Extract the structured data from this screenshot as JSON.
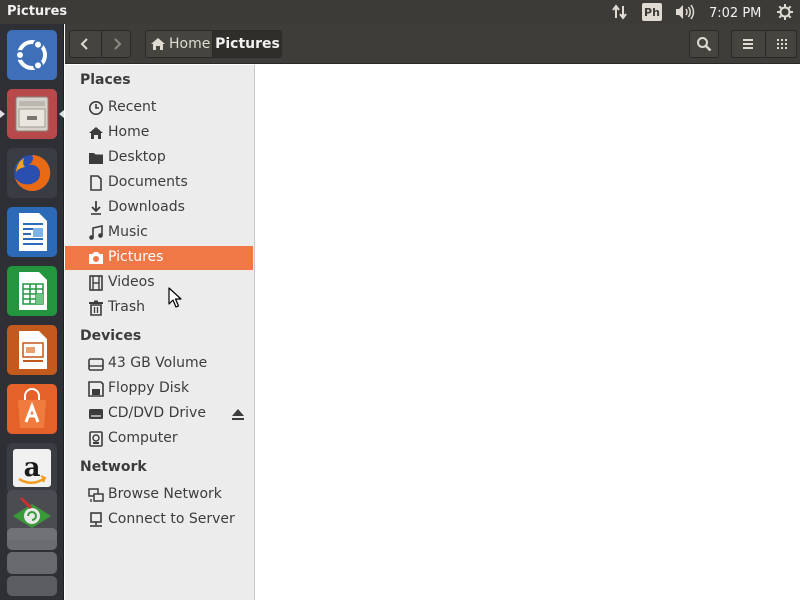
{
  "window": {
    "title": "Pictures"
  },
  "top_panel": {
    "keyboard_layout": "Ph",
    "clock": "7:02 PM",
    "icons": [
      "network-arrows-icon",
      "keyboard-layout-icon",
      "volume-icon",
      "gear-icon"
    ]
  },
  "launcher": {
    "items": [
      {
        "name": "ubuntu-dash",
        "color": "#3c6eb4"
      },
      {
        "name": "files",
        "color": "#b44646"
      },
      {
        "name": "firefox",
        "color": "#e66000"
      },
      {
        "name": "libreoffice-writer",
        "color": "#2a6ab8"
      },
      {
        "name": "libreoffice-calc",
        "color": "#1e8c3c"
      },
      {
        "name": "libreoffice-impress",
        "color": "#c0571b"
      },
      {
        "name": "ubuntu-software",
        "color": "#e8642a"
      },
      {
        "name": "amazon",
        "color": "#3a3a3a"
      },
      {
        "name": "software-updater",
        "color": "#6a6a6a"
      }
    ]
  },
  "headerbar": {
    "breadcrumbs": [
      "Home",
      "Pictures"
    ],
    "icons": [
      "back-icon",
      "forward-icon",
      "home-icon",
      "search-icon",
      "menu-icon",
      "grid-view-icon"
    ]
  },
  "sidebar": {
    "places_title": "Places",
    "places": [
      {
        "label": "Recent",
        "icon": "clock-icon"
      },
      {
        "label": "Home",
        "icon": "home-icon"
      },
      {
        "label": "Desktop",
        "icon": "folder-icon"
      },
      {
        "label": "Documents",
        "icon": "document-icon"
      },
      {
        "label": "Downloads",
        "icon": "download-icon"
      },
      {
        "label": "Music",
        "icon": "music-icon"
      },
      {
        "label": "Pictures",
        "icon": "camera-icon",
        "active": true
      },
      {
        "label": "Videos",
        "icon": "film-icon"
      },
      {
        "label": "Trash",
        "icon": "trash-icon"
      }
    ],
    "devices_title": "Devices",
    "devices": [
      {
        "label": "43 GB Volume",
        "icon": "drive-icon"
      },
      {
        "label": "Floppy Disk",
        "icon": "floppy-icon"
      },
      {
        "label": "CD/DVD Drive",
        "icon": "optical-drive-icon",
        "eject": true
      },
      {
        "label": "Computer",
        "icon": "computer-icon"
      }
    ],
    "network_title": "Network",
    "network": [
      {
        "label": "Browse Network",
        "icon": "network-icon"
      },
      {
        "label": "Connect to Server",
        "icon": "server-icon"
      }
    ]
  },
  "colors": {
    "accent": "#f07746",
    "panel": "#3c3b37",
    "launcher": "#2e3036",
    "sidebar": "#ececec"
  }
}
